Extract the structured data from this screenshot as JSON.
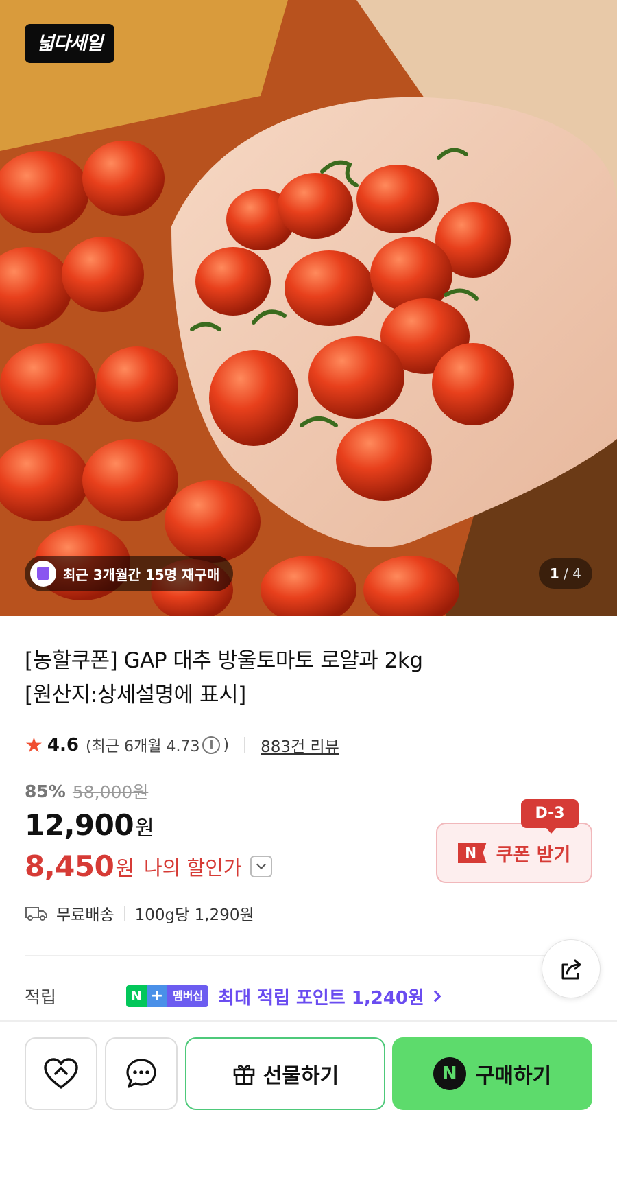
{
  "hero": {
    "brand_badge": "넓다세일",
    "rebuy_text": "최근 3개월간 15명 재구매",
    "page_current": "1",
    "page_total": "4"
  },
  "product": {
    "title_line1": "[농할쿠폰] GAP 대추 방울토마토 로얄과 2kg",
    "title_line2": "[원산지:상세설명에 표시]"
  },
  "rating": {
    "score": "4.6",
    "recent_prefix": "(최근 6개월 4.73",
    "recent_suffix": ")",
    "info_glyph": "i",
    "reviews": "883건 리뷰"
  },
  "price": {
    "discount_pct": "85%",
    "original": "58,000원",
    "sale": "12,900",
    "won": "원",
    "my_price": "8,450",
    "my_won": "원",
    "my_label": "나의 할인가"
  },
  "coupon": {
    "dday": "D-3",
    "n_mark": "N",
    "label": "쿠폰 받기"
  },
  "shipping": {
    "free": "무료배송",
    "unit_price": "100g당 1,290원"
  },
  "points": {
    "label": "적립",
    "memb_n": "N",
    "memb_plus": "+",
    "memb_text": "멤버십",
    "text": "최대 적립 포인트 1,240원"
  },
  "bottom_bar": {
    "gift_label": "선물하기",
    "buy_logo": "N",
    "buy_label": "구매하기"
  },
  "colors": {
    "accent_red": "#d63b36",
    "buy_green": "#5ddb6c",
    "membership_purple": "#6a4cf0"
  }
}
